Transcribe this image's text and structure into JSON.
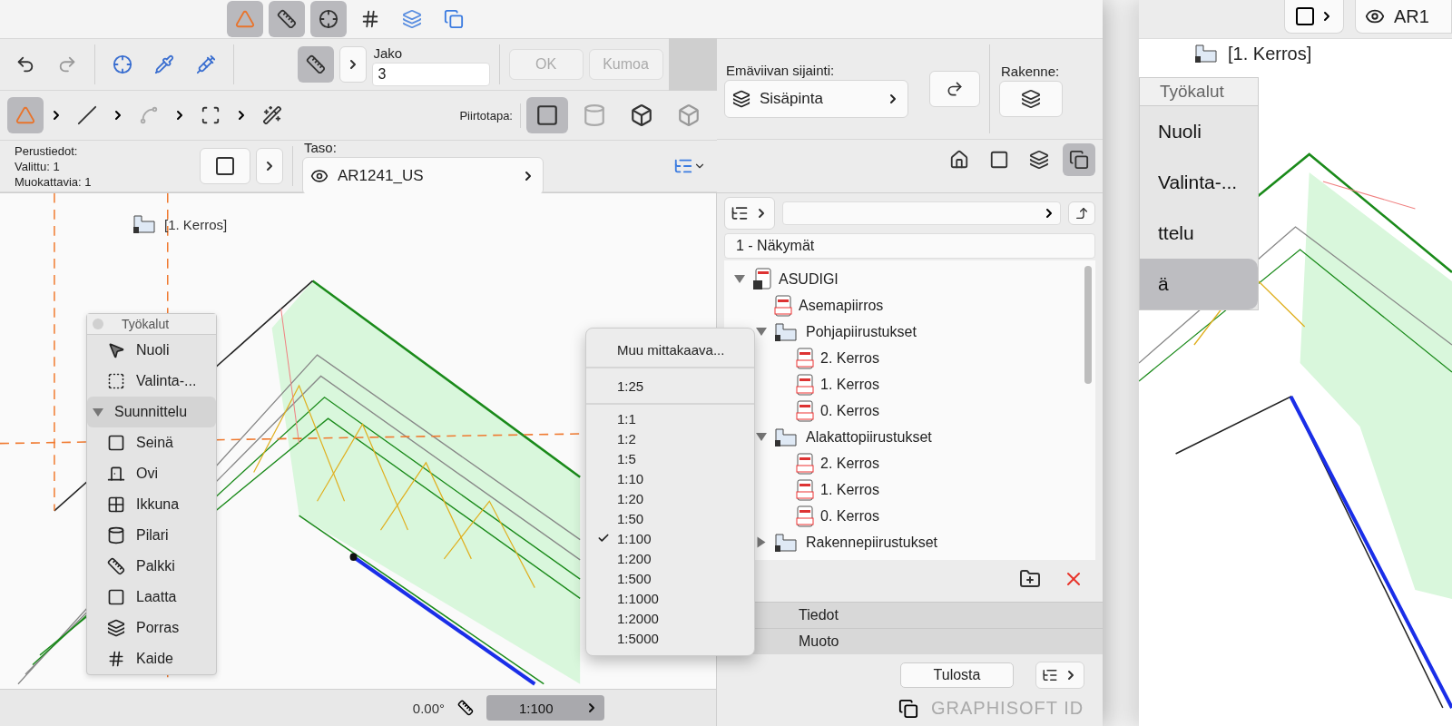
{
  "main_window": {
    "top_toolbar": [
      {
        "selected": true
      },
      {
        "selected": true
      },
      {
        "selected": true
      },
      {
        "selected": false
      },
      {
        "selected": false
      },
      {
        "selected": false
      }
    ],
    "edit_toolbar": {
      "snap_selected": true,
      "division": {
        "label": "Jako",
        "value": "3"
      },
      "ok_button": "OK",
      "cancel_button": "Kumoa"
    },
    "tool_row": [
      {
        "selected": true
      },
      {
        "selected": false
      },
      {
        "selected": false
      },
      {
        "selected": false
      },
      {
        "selected": false
      }
    ],
    "info": {
      "title": "Perustiedot:",
      "selected_count": "Valittu: 1",
      "editable_count": "Muokattavia: 1"
    },
    "layer": {
      "label": "Taso:",
      "value": "AR1241_US"
    },
    "geometry": {
      "label": "Piirtotapa:",
      "options": [
        {
          "selected": true
        },
        {
          "selected": false
        },
        {
          "selected": false
        },
        {
          "selected": false
        }
      ]
    },
    "reference_line": {
      "label": "Emäviivan sijainti:",
      "value": "Sisäpinta"
    },
    "structure": {
      "label": "Rakenne:"
    },
    "story_label": "[1. Kerros]",
    "toolbox": {
      "title": "Työkalut",
      "items": [
        {
          "kind": "tool",
          "label": "Nuoli"
        },
        {
          "kind": "tool",
          "label": "Valinta-..."
        },
        {
          "kind": "group",
          "label": "Suunnittelu",
          "expanded": true
        },
        {
          "kind": "tool",
          "label": "Seinä"
        },
        {
          "kind": "tool",
          "label": "Ovi"
        },
        {
          "kind": "tool",
          "label": "Ikkuna"
        },
        {
          "kind": "tool",
          "label": "Pilari"
        },
        {
          "kind": "tool",
          "label": "Palkki"
        },
        {
          "kind": "tool",
          "label": "Laatta"
        },
        {
          "kind": "tool",
          "label": "Porras"
        },
        {
          "kind": "tool",
          "label": "Kaide"
        }
      ]
    },
    "scale_menu": {
      "groups": [
        {
          "items": [
            {
              "label": "Muu mittakaava...",
              "checked": false
            }
          ]
        },
        {
          "items": [
            {
              "label": "1:25",
              "checked": false
            }
          ]
        },
        {
          "items": [
            {
              "label": "1:1",
              "checked": false
            },
            {
              "label": "1:2",
              "checked": false
            },
            {
              "label": "1:5",
              "checked": false
            },
            {
              "label": "1:10",
              "checked": false
            },
            {
              "label": "1:20",
              "checked": false
            },
            {
              "label": "1:50",
              "checked": false
            },
            {
              "label": "1:100",
              "checked": true
            },
            {
              "label": "1:200",
              "checked": false
            },
            {
              "label": "1:500",
              "checked": false
            },
            {
              "label": "1:1000",
              "checked": false
            },
            {
              "label": "1:2000",
              "checked": false
            },
            {
              "label": "1:5000",
              "checked": false
            }
          ]
        }
      ]
    },
    "navigator": {
      "views": [
        {
          "selected": false
        },
        {
          "selected": false
        },
        {
          "selected": false
        },
        {
          "selected": true
        }
      ],
      "view_set": "1 - Näkymät",
      "tree": [
        {
          "kind": "book",
          "label": "ASUDIGI",
          "expanded": true,
          "children": [
            {
              "kind": "pdf",
              "label": "Asemapiirros"
            },
            {
              "kind": "folder",
              "label": "Pohjapiirustukset",
              "expanded": true,
              "children": [
                {
                  "kind": "pdf",
                  "label": "2. Kerros"
                },
                {
                  "kind": "pdf",
                  "label": "1. Kerros"
                },
                {
                  "kind": "pdf",
                  "label": "0. Kerros"
                }
              ]
            },
            {
              "kind": "folder",
              "label": "Alakattopiirustukset",
              "expanded": true,
              "children": [
                {
                  "kind": "pdf",
                  "label": "2. Kerros"
                },
                {
                  "kind": "pdf",
                  "label": "1. Kerros"
                },
                {
                  "kind": "pdf",
                  "label": "0. Kerros"
                }
              ]
            },
            {
              "kind": "folder",
              "label": "Rakennepiirustukset",
              "expanded": false
            }
          ]
        }
      ],
      "sections": [
        "Tiedot",
        "Muoto"
      ],
      "print_button": "Tulosta",
      "brand": "GRAPHISOFT ID"
    },
    "status_bar": {
      "angle": "0.00°",
      "scale": "1:100"
    }
  },
  "second_window": {
    "story_label": "[1. Kerros]",
    "layer_value": "AR1",
    "toolbox": {
      "title": "Työkalut",
      "items": [
        {
          "label": "Nuoli",
          "selected": false
        },
        {
          "label": "Valinta-...",
          "selected": false
        },
        {
          "label": "ttelu",
          "selected": false
        },
        {
          "label": "ä",
          "selected": true
        }
      ]
    }
  }
}
